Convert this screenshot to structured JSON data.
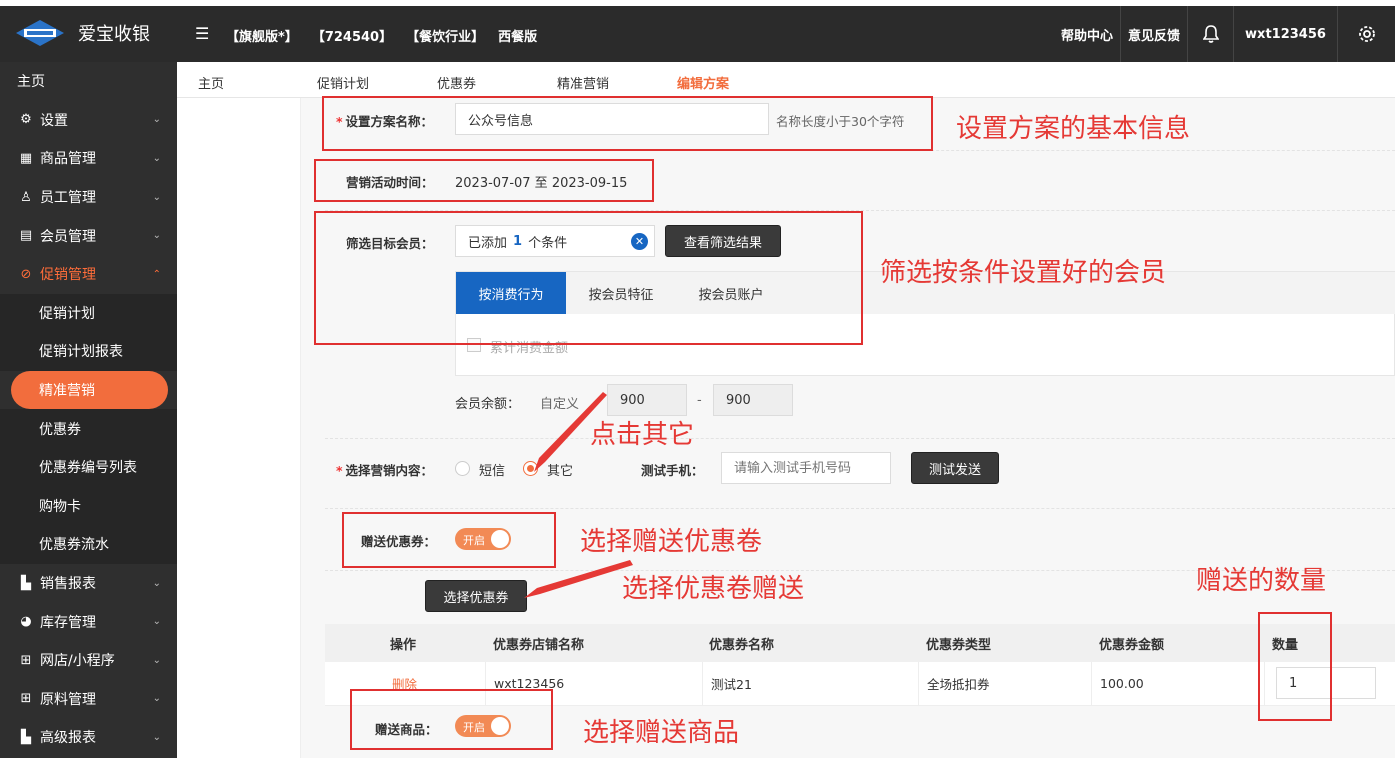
{
  "header": {
    "brand": "爱宝收银",
    "tags": [
      "【旗舰版*】",
      "【724540】",
      "【餐饮行业】",
      "西餐版"
    ],
    "help": "帮助中心",
    "feedback": "意见反馈",
    "username": "wxt123456"
  },
  "sidebar": {
    "items": [
      {
        "label": "主页",
        "icon": "none"
      },
      {
        "label": "设置",
        "icon": "gear-icon"
      },
      {
        "label": "商品管理",
        "icon": "barcode-icon"
      },
      {
        "label": "员工管理",
        "icon": "user-icon"
      },
      {
        "label": "会员管理",
        "icon": "member-icon"
      },
      {
        "label": "促销管理",
        "icon": "promo-icon"
      }
    ],
    "sub_items": [
      "促销计划",
      "促销计划报表",
      "精准营销",
      "优惠券",
      "优惠券编号列表",
      "购物卡",
      "优惠券流水"
    ],
    "items_after": [
      {
        "label": "销售报表",
        "icon": "bar-chart-icon"
      },
      {
        "label": "库存管理",
        "icon": "pie-chart-icon"
      },
      {
        "label": "网店/小程序",
        "icon": "shop-icon"
      },
      {
        "label": "原料管理",
        "icon": "shop-icon"
      },
      {
        "label": "高级报表",
        "icon": "bar-chart-icon"
      }
    ]
  },
  "nav_tabs": [
    "主页",
    "促销计划",
    "优惠券",
    "精准营销",
    "编辑方案"
  ],
  "form": {
    "name_label": "设置方案名称：",
    "name_value": "公众号信息",
    "name_hint": "名称长度小于30个字符",
    "time_label": "营销活动时间：",
    "time_value": "2023-07-07 至 2023-09-15",
    "filter_label": "筛选目标会员：",
    "filter_prefix": "已添加",
    "filter_count": "1",
    "filter_suffix": "个条件",
    "view_result_button": "查看筛选结果",
    "filter_tabs": [
      "按消费行为",
      "按会员特征",
      "按会员账户"
    ],
    "checkbox_label": "累计消费金额",
    "balance_label": "会员余额：",
    "balance_mode": "自定义",
    "balance_min": "900",
    "balance_sep": "-",
    "balance_max": "900",
    "content_label": "选择营销内容：",
    "radio_sms": "短信",
    "radio_other": "其它",
    "test_phone_label": "测试手机：",
    "test_phone_placeholder": "请输入测试手机号码",
    "test_send_button": "测试发送",
    "gift_coupon_label": "赠送优惠券：",
    "gift_coupon_toggle": "开启",
    "choose_coupon_button": "选择优惠券",
    "gift_goods_label": "赠送商品：",
    "gift_goods_toggle": "开启"
  },
  "coupon_table": {
    "headers": [
      "操作",
      "优惠券店铺名称",
      "优惠券名称",
      "优惠券类型",
      "优惠券金额",
      "数量"
    ],
    "rows": [
      {
        "action": "删除",
        "shop": "wxt123456",
        "name": "测试21",
        "type": "全场抵扣券",
        "amount": "100.00",
        "quantity": "1"
      }
    ]
  },
  "annotations": {
    "basic_info": "设置方案的基本信息",
    "filter_members": "筛选按条件设置好的会员",
    "click_other": "点击其它",
    "gift_coupon": "选择赠送优惠卷",
    "choose_coupon": "选择优惠卷赠送",
    "quantity": "赠送的数量",
    "gift_goods": "选择赠送商品"
  },
  "colors": {
    "accent": "#f26d3d",
    "annotation_red": "#e53935",
    "topbar": "#2b2b2b",
    "sidebar": "#2f2f2f",
    "tab_blue": "#1766c2"
  }
}
